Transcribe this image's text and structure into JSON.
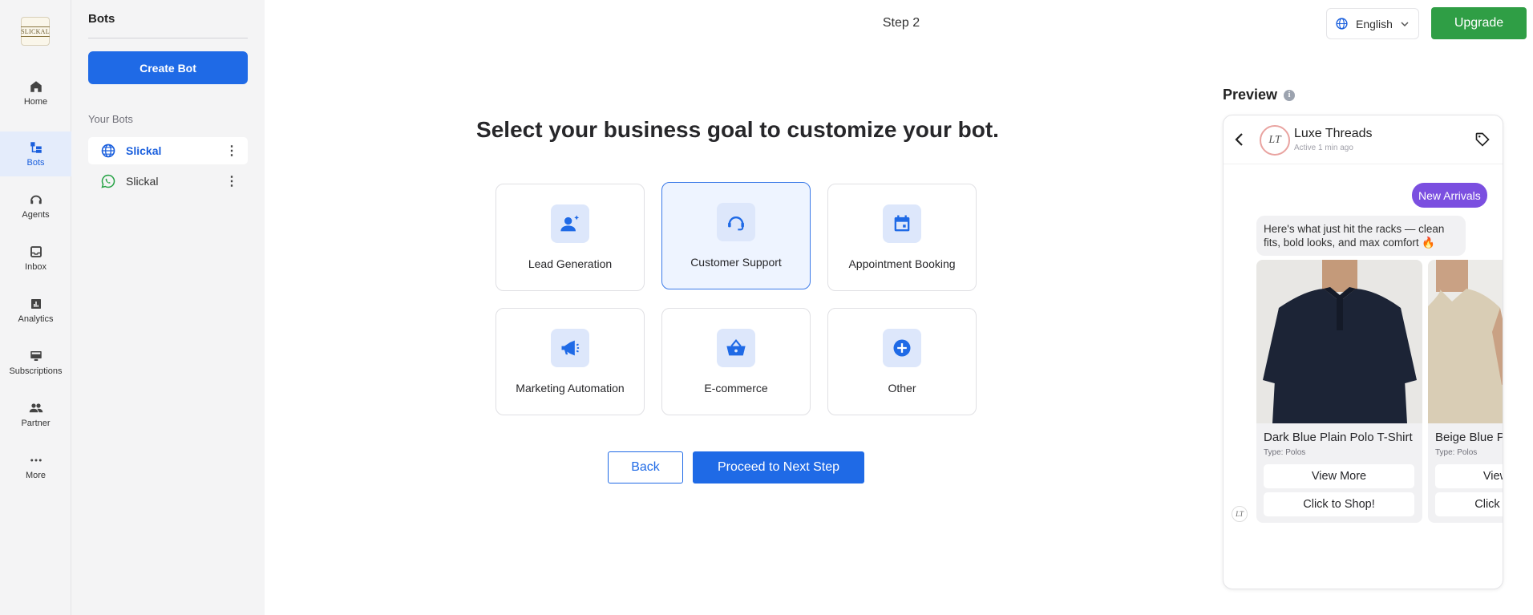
{
  "app": {
    "logo_text": "SLICKAL"
  },
  "nav": {
    "items": [
      {
        "label": "Home",
        "icon": "home-icon"
      },
      {
        "label": "Bots",
        "icon": "bots-icon",
        "active": true
      },
      {
        "label": "Agents",
        "icon": "agents-icon"
      },
      {
        "label": "Inbox",
        "icon": "inbox-icon"
      },
      {
        "label": "Analytics",
        "icon": "analytics-icon"
      },
      {
        "label": "Subscriptions",
        "icon": "subscriptions-icon"
      },
      {
        "label": "Partner",
        "icon": "partner-icon"
      },
      {
        "label": "More",
        "icon": "more-icon"
      }
    ]
  },
  "bots_panel": {
    "title": "Bots",
    "create_label": "Create Bot",
    "section_label": "Your Bots",
    "bots": [
      {
        "name": "Slickal",
        "channel": "web",
        "icon": "globe-icon",
        "active": true
      },
      {
        "name": "Slickal",
        "channel": "whatsapp",
        "icon": "whatsapp-icon",
        "active": false
      }
    ]
  },
  "header": {
    "step": "Step 2",
    "language": "English",
    "upgrade_label": "Upgrade"
  },
  "main": {
    "headline": "Select your business goal to customize your bot.",
    "goals": [
      {
        "label": "Lead Generation",
        "icon": "lead-icon",
        "selected": false
      },
      {
        "label": "Customer Support",
        "icon": "support-icon",
        "selected": true
      },
      {
        "label": "Appointment Booking",
        "icon": "calendar-icon",
        "selected": false
      },
      {
        "label": "Marketing Automation",
        "icon": "megaphone-icon",
        "selected": false
      },
      {
        "label": "E-commerce",
        "icon": "basket-icon",
        "selected": false
      },
      {
        "label": "Other",
        "icon": "plus-icon",
        "selected": false
      }
    ],
    "back_label": "Back",
    "next_label": "Proceed to Next Step"
  },
  "preview": {
    "title": "Preview",
    "chat_name": "Luxe Threads",
    "chat_status": "Active 1 min ago",
    "quick_reply": "New Arrivals",
    "message": "Here's what just hit the racks — clean fits, bold looks, and max comfort 🔥",
    "products": [
      {
        "name": "Dark Blue Plain Polo T-Shirt",
        "type": "Type: Polos",
        "btn1": "View More",
        "btn2": "Click to Shop!"
      },
      {
        "name": "Beige Blue Plain Polo T-Shirt",
        "type": "Type: Polos",
        "btn1": "View More",
        "btn2": "Click to Shop!"
      }
    ]
  },
  "colors": {
    "primary": "#1f6ae6",
    "upgrade": "#2f9e45",
    "quick_reply": "#7b4fe0"
  }
}
